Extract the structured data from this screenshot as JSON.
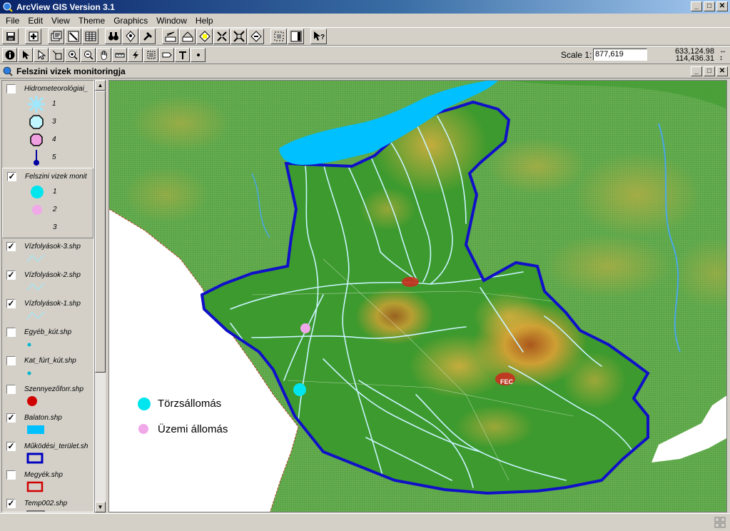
{
  "app": {
    "title": "ArcView GIS Version 3.1"
  },
  "menu": [
    "File",
    "Edit",
    "View",
    "Theme",
    "Graphics",
    "Window",
    "Help"
  ],
  "scale": {
    "label": "Scale 1:",
    "value": "877,619"
  },
  "coords": {
    "x": "633,124.98",
    "y": "114,436.31"
  },
  "view": {
    "title": "Felszini vizek monitoringja"
  },
  "toc": {
    "layers": [
      {
        "name": "Hidrometeorológiai_",
        "checked": false,
        "legend": [
          {
            "label": "1",
            "icon": "star-sky"
          },
          {
            "label": "3",
            "icon": "octagon-cyan"
          },
          {
            "label": "4",
            "icon": "octagon-pink"
          },
          {
            "label": "5",
            "icon": "pin-blue"
          }
        ]
      },
      {
        "name": "Felszini vizek monit",
        "checked": true,
        "active": true,
        "legend": [
          {
            "label": "1",
            "icon": "dot-cyan"
          },
          {
            "label": "2",
            "icon": "dot-pink"
          },
          {
            "label": "3",
            "icon": "none"
          }
        ]
      },
      {
        "name": "Vízfolyások-3.shp",
        "checked": true,
        "legend": [
          {
            "label": "",
            "icon": "line-light"
          }
        ]
      },
      {
        "name": "Vízfolyások-2.shp",
        "checked": true,
        "legend": [
          {
            "label": "",
            "icon": "line-light"
          }
        ]
      },
      {
        "name": "Vízfolyások-1.shp",
        "checked": true,
        "legend": [
          {
            "label": "",
            "icon": "line-light"
          }
        ]
      },
      {
        "name": "Egyéb_kút.shp",
        "checked": false,
        "legend": [
          {
            "label": "",
            "icon": "dot-small-cyan"
          }
        ]
      },
      {
        "name": "Kat_fúrt_kút.shp",
        "checked": false,
        "legend": [
          {
            "label": "",
            "icon": "dot-small-cyan"
          }
        ]
      },
      {
        "name": "Szennyezőforr.shp",
        "checked": false,
        "legend": [
          {
            "label": "",
            "icon": "dot-red"
          }
        ]
      },
      {
        "name": "Balaton.shp",
        "checked": true,
        "legend": [
          {
            "label": "",
            "icon": "rect-cyan"
          }
        ]
      },
      {
        "name": "Működési_terület.sh",
        "checked": true,
        "legend": [
          {
            "label": "",
            "icon": "rect-blue-outline"
          }
        ]
      },
      {
        "name": "Megyék.shp",
        "checked": false,
        "legend": [
          {
            "label": "",
            "icon": "rect-red-outline"
          }
        ]
      },
      {
        "name": "Temp002.shp",
        "checked": true,
        "legend": [
          {
            "label": "",
            "icon": "rect-grey-outline"
          }
        ]
      }
    ]
  },
  "map_legend": {
    "primary": {
      "label": "Törzsállomás",
      "color": "#00e5ee"
    },
    "plant": {
      "label": "Üzemi állomás",
      "color": "#f0a8e8"
    }
  },
  "map_labels": [
    "FEC"
  ],
  "colors": {
    "lake": "#00c0ff",
    "boundary": "#1010c8",
    "lowland": "#3c9a30",
    "hills": "#c8a030",
    "outside": "#5ea84a",
    "river": "#bff0ff"
  }
}
